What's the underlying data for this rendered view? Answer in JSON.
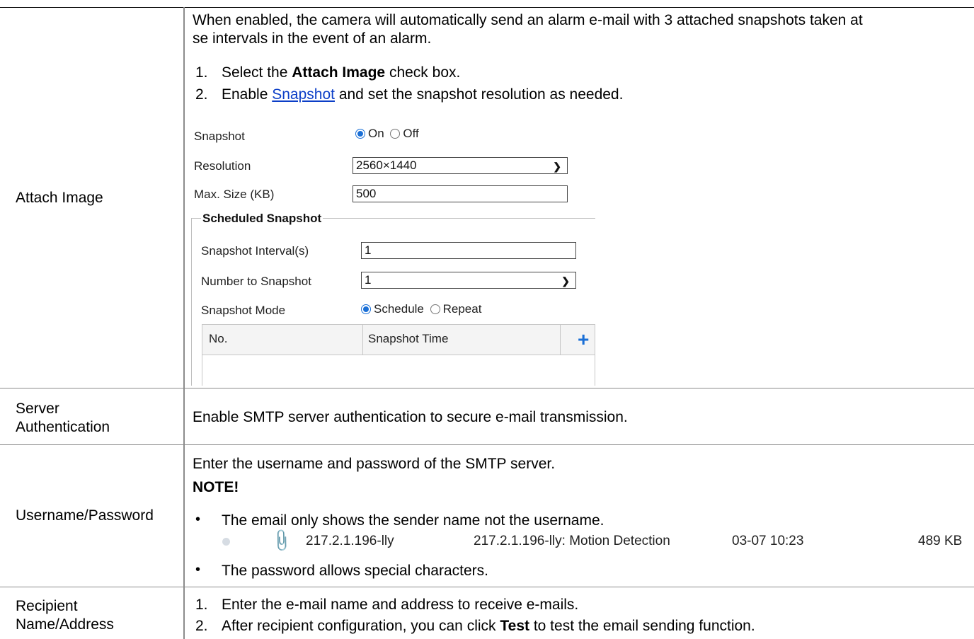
{
  "rows": {
    "attach_image": {
      "label": "Attach Image",
      "desc_line1": "When enabled, the camera will automatically send an alarm e-mail with 3 attached snapshots taken at",
      "desc_line2": "se intervals in the event of an alarm.",
      "step1_num": "1.",
      "step1_pre": "Select the ",
      "step1_bold": "Attach Image",
      "step1_post": " check box.",
      "step2_num": "2.",
      "step2_pre": "Enable ",
      "step2_link": "Snapshot",
      "step2_post": " and set the snapshot resolution as needed."
    },
    "server_auth": {
      "label_line1": "Server",
      "label_line2": "Authentication",
      "desc": "Enable SMTP server authentication to secure e-mail transmission."
    },
    "username_password": {
      "label": "Username/Password",
      "desc": "Enter the username and password of the SMTP server.",
      "note_title": "NOTE!",
      "bullet1": "The email only shows the sender name not the username.",
      "bullet2": "The password allows special characters.",
      "bullet_char": "•"
    },
    "recipient": {
      "label_line1": "Recipient",
      "label_line2": "Name/Address",
      "step1_num": "1.",
      "step1": "Enter the e-mail name and address to receive e-mails.",
      "step2_num": "2.",
      "step2_pre": "After recipient configuration, you can click ",
      "step2_bold": "Test",
      "step2_post": " to test the email sending function."
    }
  },
  "snapshot_ui": {
    "snapshot_label": "Snapshot",
    "on_label": "On",
    "off_label": "Off",
    "resolution_label": "Resolution",
    "resolution_value": "2560×1440",
    "max_size_label": "Max. Size (KB)",
    "max_size_value": "500",
    "scheduled_title": "Scheduled Snapshot",
    "interval_label": "Snapshot Interval(s)",
    "interval_value": "1",
    "number_label": "Number to Snapshot",
    "number_value": "1",
    "mode_label": "Snapshot Mode",
    "mode_schedule": "Schedule",
    "mode_repeat": "Repeat",
    "col_no": "No.",
    "col_time": "Snapshot Time",
    "add_symbol": "+",
    "chevron_icon": "chevron-down-icon"
  },
  "mail_sample": {
    "sender": "217.2.1.196-lly",
    "subject": "217.2.1.196-lly: Motion Detection",
    "date": "03-07 10:23",
    "size": "489 KB",
    "attachment_icon": "paperclip-icon"
  }
}
